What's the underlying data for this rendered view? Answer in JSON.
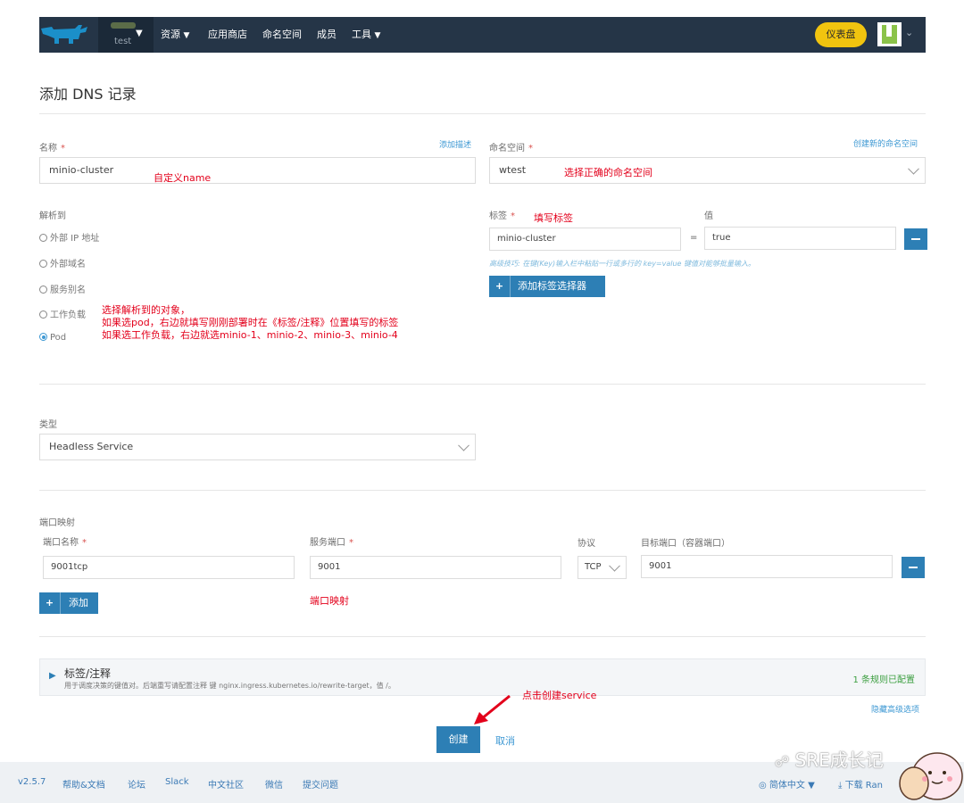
{
  "nav": {
    "cluster_name": "test",
    "items": [
      "资源",
      "应用商店",
      "命名空间",
      "成员",
      "工具"
    ],
    "dashboard_label": "仪表盘"
  },
  "page": {
    "title": "添加 DNS 记录"
  },
  "form": {
    "name": {
      "label": "名称",
      "required": "*",
      "add_desc_link": "添加描述",
      "value": "minio-cluster"
    },
    "namespace": {
      "label": "命名空间",
      "required": "*",
      "create_link": "创建新的命名空间",
      "value": "wtest"
    },
    "resolve_to": {
      "label": "解析到",
      "options": [
        "外部 IP 地址",
        "外部域名",
        "服务别名",
        "工作负载",
        "Pod"
      ],
      "selected": "Pod"
    },
    "labels": {
      "label": "标签",
      "required": "*",
      "value_label": "值",
      "key": "minio-cluster",
      "equals": "=",
      "value": "true",
      "tip": "高级技巧: 在键(Key)输入栏中粘贴一行或多行的 key=value 键值对能够批量输入。",
      "add_selector_button": "添加标签选择器"
    },
    "type": {
      "label": "类型",
      "value": "Headless Service"
    },
    "ports": {
      "section_label": "端口映射",
      "name_label": "端口名称",
      "service_port_label": "服务端口",
      "protocol_label": "协议",
      "target_port_label": "目标端口（容器端口）",
      "name_value": "9001tcp",
      "service_port_value": "9001",
      "protocol_value": "TCP",
      "target_port_value": "9001",
      "add_button": "添加"
    },
    "annotations": {
      "title": "标签/注释",
      "subtitle": "用于调度决策的键值对。后端重写请配置注释 键 nginx.ingress.kubernetes.io/rewrite-target，值 /。",
      "status": "1 条规则已配置",
      "hide_advanced_link": "隐藏高级选项"
    },
    "create_button": "创建",
    "cancel_button": "取消"
  },
  "annotations_overlay": {
    "name_note": "自定义name",
    "namespace_note": "选择正确的命名空间",
    "label_note": "填写标签",
    "resolve_note_1": "选择解析到的对象，",
    "resolve_note_2": "如果选pod，右边就填写刚刚部署时在《标签/注释》位置填写的标签",
    "resolve_note_3": "如果选工作负载，右边就选minio-1、minio-2、minio-3、minio-4",
    "port_note": "端口映射",
    "create_note": "点击创建service"
  },
  "footer": {
    "version": "v2.5.7",
    "links": [
      "帮助&文档",
      "论坛",
      "Slack",
      "中文社区",
      "微信",
      "提交问题"
    ],
    "language": "简体中文",
    "download": "下载 Ran"
  },
  "watermark": {
    "text": "SRE成长记"
  },
  "colors": {
    "nav_bg": "#253547",
    "primary": "#2d7fb5",
    "dashboard": "#f1c40f",
    "annotation_red": "#e3001b",
    "success_green": "#3c9f40"
  }
}
